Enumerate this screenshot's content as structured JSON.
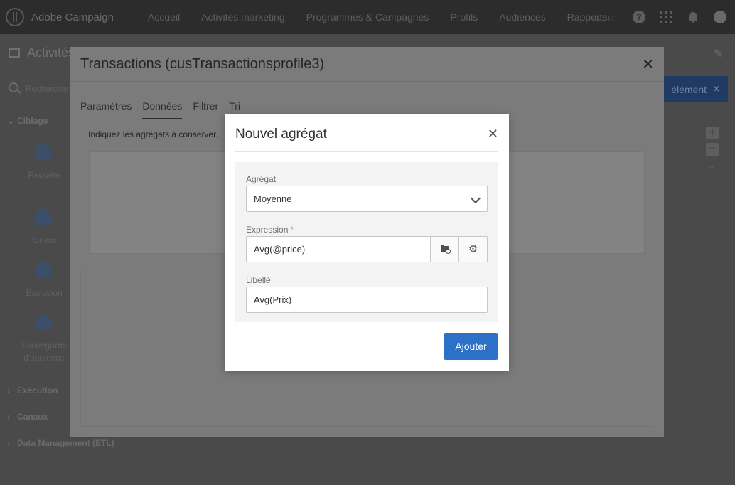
{
  "app": {
    "logo_text": "Adobe Campaign",
    "nav_items": [
      "Accueil",
      "Activités marketing",
      "Programmes & Campagnes",
      "Profils",
      "Audiences",
      "Rapports"
    ],
    "user": "admin",
    "help_icon": "?"
  },
  "background": {
    "page_title": "Activités",
    "search_placeholder": "Rechercher",
    "blue_button_label": "élément",
    "categories": {
      "ciblage": "Ciblage",
      "execution": "Exécution",
      "canaux": "Canaux",
      "data_management": "Data Management (ETL)"
    },
    "activities": {
      "requete": "Requête",
      "union": "Union",
      "exclusion": "Exclusion",
      "sauvegarde_line1": "Sauvegarde",
      "sauvegarde_line2": "d'audience"
    }
  },
  "outer_dialog": {
    "title": "Transactions (cusTransactionsprofile3)",
    "tabs": [
      "Paramètres",
      "Données",
      "Filtrer",
      "Tri"
    ],
    "active_tab": "Données",
    "hint": "Indiquez les agrégats à conserver."
  },
  "inner_dialog": {
    "title": "Nouvel agrégat",
    "aggregate": {
      "label": "Agrégat",
      "value": "Moyenne"
    },
    "expression": {
      "label": "Expression",
      "required_mark": "*",
      "value": "Avg(@price)"
    },
    "libelle": {
      "label": "Libellé",
      "value": "Avg(Prix)"
    },
    "add_button_label": "Ajouter"
  },
  "colors": {
    "primary_button": "#2d70c8",
    "required": "#e68619",
    "topbar": "#2c2c2c"
  }
}
